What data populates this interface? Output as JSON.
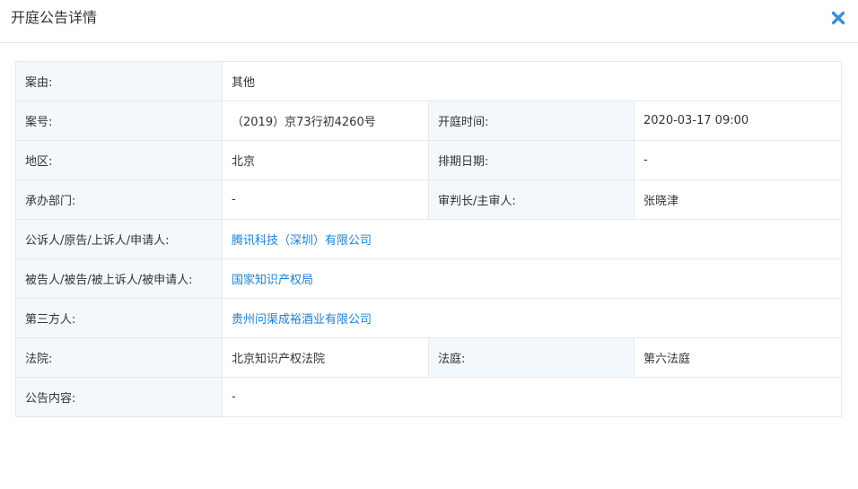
{
  "header": {
    "title": "开庭公告详情",
    "close_icon": "close-icon",
    "accent_color": "#3b8fdb"
  },
  "rows": {
    "case_reason": {
      "label": "案由:",
      "value": "其他"
    },
    "case_number": {
      "label": "案号:",
      "value": "（2019）京73行初4260号"
    },
    "hearing_time": {
      "label": "开庭时间:",
      "value": "2020-03-17 09:00"
    },
    "region": {
      "label": "地区:",
      "value": "北京"
    },
    "schedule_date": {
      "label": "排期日期:",
      "value": "-"
    },
    "department": {
      "label": "承办部门:",
      "value": "-"
    },
    "chief_judge": {
      "label": "审判长/主审人:",
      "value": "张晓津"
    },
    "plaintiff": {
      "label": "公诉人/原告/上诉人/申请人:",
      "value": "腾讯科技（深圳）有限公司"
    },
    "defendant": {
      "label": "被告人/被告/被上诉人/被申请人:",
      "value": "国家知识产权局"
    },
    "third_party": {
      "label": "第三方人:",
      "value": "贵州问渠成裕酒业有限公司"
    },
    "court": {
      "label": "法院:",
      "value": "北京知识产权法院"
    },
    "courtroom": {
      "label": "法庭:",
      "value": "第六法庭"
    },
    "content": {
      "label": "公告内容:",
      "value": "-"
    }
  },
  "colors": {
    "label_bg": "#f2f8fc",
    "border": "#e6e9ee",
    "link": "#1a7fd4"
  }
}
